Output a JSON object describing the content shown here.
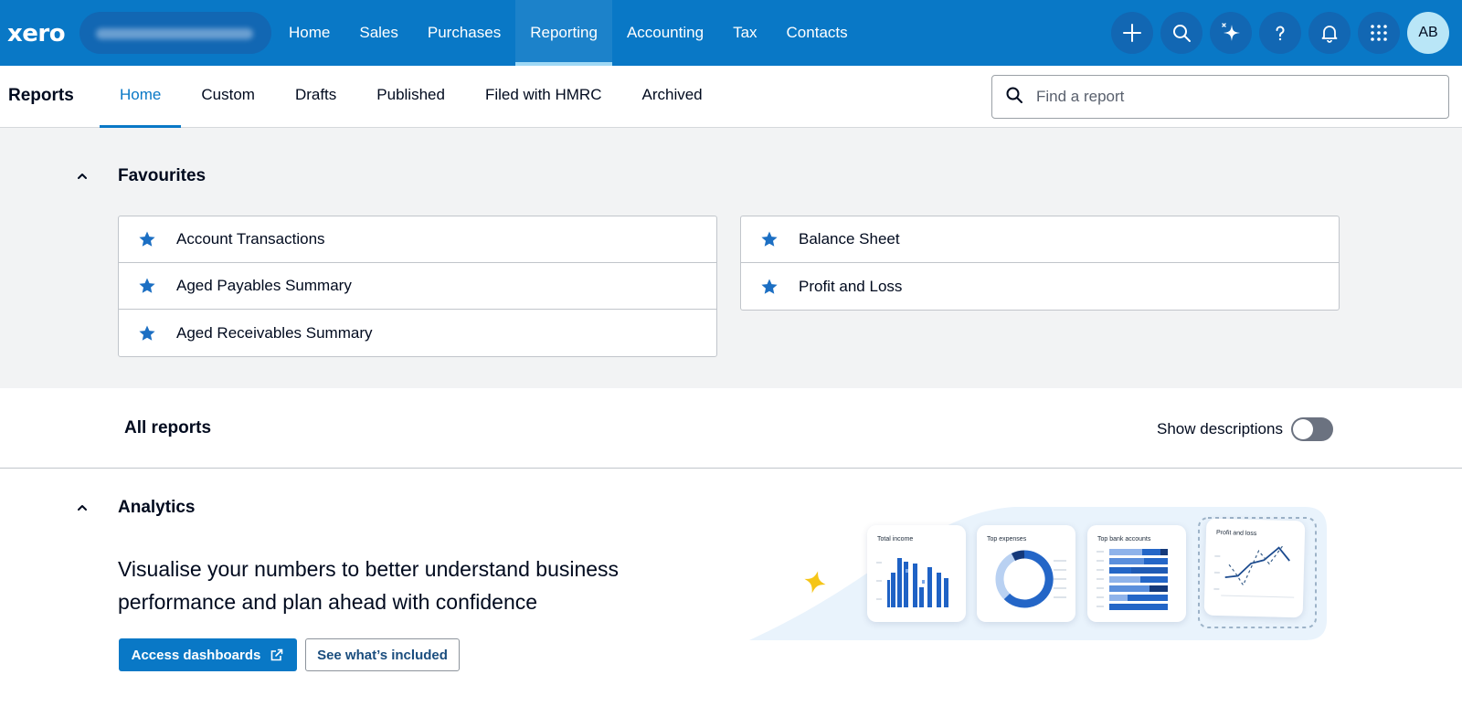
{
  "topbar": {
    "logo": "xero",
    "nav": [
      "Home",
      "Sales",
      "Purchases",
      "Reporting",
      "Accounting",
      "Tax",
      "Contacts"
    ],
    "active_nav": "Reporting",
    "avatar_initials": "AB",
    "icons": [
      "plus-icon",
      "search-icon",
      "sparkle-icon",
      "help-icon",
      "bell-icon",
      "apps-grid-icon"
    ]
  },
  "subnav": {
    "title": "Reports",
    "tabs": [
      "Home",
      "Custom",
      "Drafts",
      "Published",
      "Filed with HMRC",
      "Archived"
    ],
    "active_tab": "Home",
    "search_placeholder": "Find a report"
  },
  "favourites": {
    "title": "Favourites",
    "left": [
      "Account Transactions",
      "Aged Payables Summary",
      "Aged Receivables Summary"
    ],
    "right": [
      "Balance Sheet",
      "Profit and Loss"
    ]
  },
  "all_reports": {
    "title": "All reports",
    "show_descriptions_label": "Show descriptions",
    "show_descriptions": false
  },
  "analytics": {
    "title": "Analytics",
    "description": "Visualise your numbers to better understand business performance and plan ahead with confidence",
    "primary_button": "Access dashboards",
    "secondary_button": "See what’s included",
    "cards": [
      "Total income",
      "Top expenses",
      "Top bank accounts",
      "Profit and loss"
    ]
  },
  "colors": {
    "brand": "#0978c6",
    "star": "#1c6fc3",
    "accent_yellow": "#f5c518"
  }
}
